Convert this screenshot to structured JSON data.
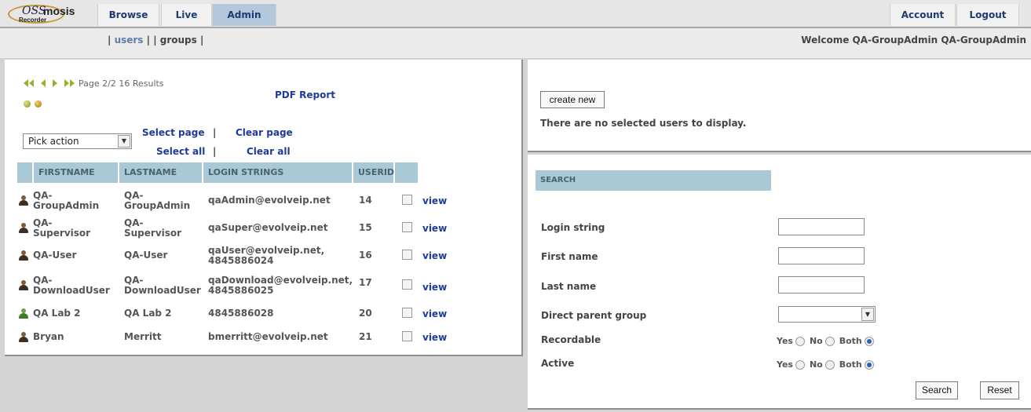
{
  "app": {
    "logo_main": "OSS",
    "logo_bold": "mosis",
    "logo_sub": "Recorder"
  },
  "nav": {
    "browse": "Browse",
    "live": "Live",
    "admin": "Admin",
    "account": "Account",
    "logout": "Logout"
  },
  "subnav": {
    "pre": "| ",
    "users": "users",
    "mid": " | | ",
    "groups": "groups",
    "post": " |"
  },
  "welcome": "Welcome QA-GroupAdmin QA-GroupAdmin",
  "pager": {
    "text": "Page 2/2 16 Results",
    "pdf": "PDF Report"
  },
  "colors": {
    "dot1": "#a8b23c",
    "dot2": "#c79a2a",
    "header_bg": "#a9c9d7",
    "link": "#1e3a9a"
  },
  "actions": {
    "pick_action": "Pick action",
    "select_page": "Select page",
    "clear_page": "Clear page",
    "select_all": "Select all",
    "clear_all": "Clear all",
    "sep": "|"
  },
  "table": {
    "headers": [
      "FIRSTNAME",
      "LASTNAME",
      "LOGIN STRINGS",
      "USERID"
    ],
    "rows": [
      {
        "first": "QA-\nGroupAdmin",
        "last": "QA-\nGroupAdmin",
        "login": "qaAdmin@evolveip.net",
        "userid": "14",
        "view": "view",
        "icon": "user-icon"
      },
      {
        "first": "QA-\nSupervisor",
        "last": "QA-\nSupervisor",
        "login": "qaSuper@evolveip.net",
        "userid": "15",
        "view": "view",
        "icon": "user-icon"
      },
      {
        "first": "QA-User",
        "last": "QA-User",
        "login": "qaUser@evolveip.net,\n4845886024",
        "userid": "16",
        "view": "view",
        "icon": "user-icon"
      },
      {
        "first": "QA-\nDownloadUser",
        "last": "QA-\nDownloadUser",
        "login": "qaDownload@evolveip.net,\n4845886025",
        "userid": "17",
        "view": "view",
        "icon": "user-icon"
      },
      {
        "first": "QA Lab 2",
        "last": "QA Lab 2",
        "login": "4845886028",
        "userid": "20",
        "view": "view",
        "icon": "user-green-icon"
      },
      {
        "first": "Bryan",
        "last": "Merritt",
        "login": "bmerritt@evolveip.net",
        "userid": "21",
        "view": "view",
        "icon": "user-icon"
      }
    ]
  },
  "right": {
    "create_new": "create new",
    "no_selected": "There are no selected users to display."
  },
  "search": {
    "title": "SEARCH",
    "login_string": "Login string",
    "first_name": "First name",
    "last_name": "Last name",
    "direct_parent_group": "Direct parent group",
    "recordable": "Recordable",
    "active": "Active",
    "yes": "Yes",
    "no": "No",
    "both": "Both",
    "search_btn": "Search",
    "reset_btn": "Reset"
  }
}
